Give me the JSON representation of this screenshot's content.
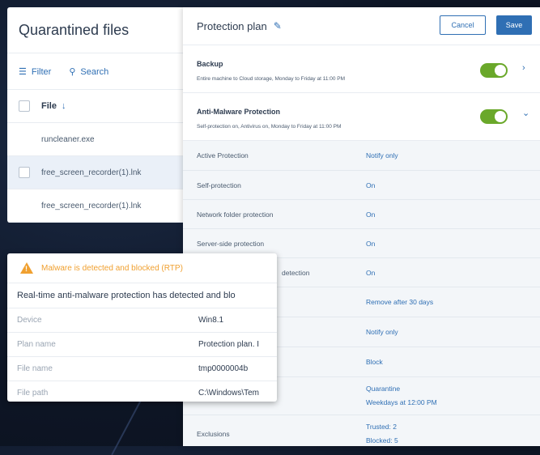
{
  "quarantine": {
    "title": "Quarantined files",
    "filter_label": "Filter",
    "search_label": "Search",
    "column_file": "File",
    "rows": [
      "runcleaner.exe",
      "free_screen_recorder(1).lnk",
      "free_screen_recorder(1).lnk"
    ]
  },
  "plan": {
    "title": "Protection plan",
    "cancel_label": "Cancel",
    "save_label": "Save",
    "backup": {
      "title": "Backup",
      "subtitle": "Entire machine to Cloud storage, Monday to Friday at 11:00 PM",
      "enabled": true
    },
    "antimalware": {
      "title": "Anti-Malware Protection",
      "subtitle": "Self-protection on, Antivirus on, Monday to Friday at 11:00 PM",
      "enabled": true
    },
    "rows": [
      {
        "label": "Active Protection",
        "value": "Notify only"
      },
      {
        "label": "Self-protection",
        "value": "On"
      },
      {
        "label": "Network folder protection",
        "value": "On"
      },
      {
        "label": "Server-side protection",
        "value": "On"
      },
      {
        "label": "detection",
        "value": "On"
      },
      {
        "label": "",
        "value": "Remove after 30 days"
      },
      {
        "label": "",
        "value": "Notify only"
      },
      {
        "label": "",
        "value": "Block"
      },
      {
        "label": "",
        "value": "Quarantine",
        "value2": "Weekdays at 12:00 PM"
      },
      {
        "label": "Exclusions",
        "value": "Trusted: 2",
        "value2": "Blocked: 5"
      }
    ]
  },
  "alert": {
    "title": "Malware is detected and blocked (RTP)",
    "description": "Real-time anti-malware protection has detected and blo",
    "fields": [
      {
        "label": "Device",
        "value": "Win8.1"
      },
      {
        "label": "Plan name",
        "value": "Protection plan. I"
      },
      {
        "label": "File name",
        "value": "tmp0000004b"
      },
      {
        "label": "File path",
        "value": "C:\\Windows\\Tem"
      }
    ]
  },
  "colors": {
    "accent": "#2f6fb4",
    "toggle_on": "#6aa82a",
    "warning": "#f0a030"
  }
}
